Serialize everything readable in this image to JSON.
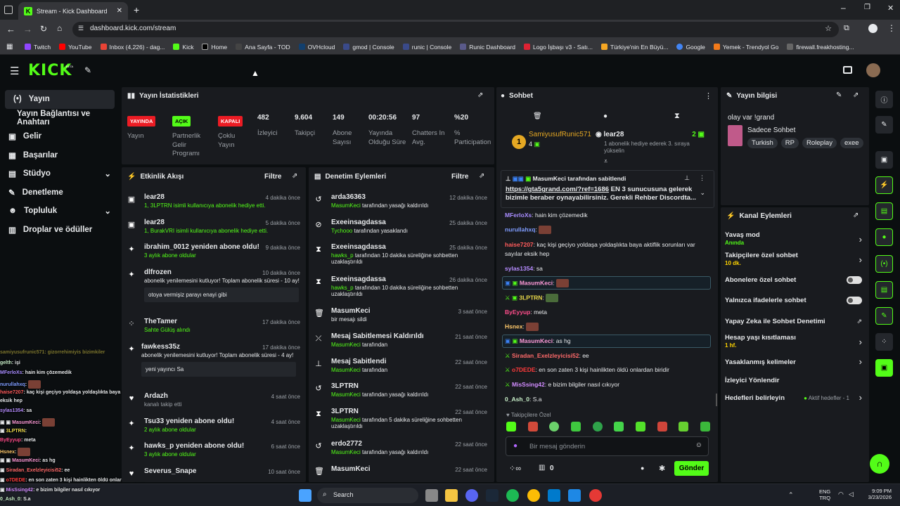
{
  "browser": {
    "tab_title": "Stream - Kick Dashboard",
    "url": "dashboard.kick.com/stream",
    "bookmarks": [
      "Twitch",
      "YouTube",
      "Inbox (4,226) - dag...",
      "Kick",
      "Home",
      "Ana Sayfa - TOD",
      "OVHcloud",
      "gmod | Console",
      "runic | Console",
      "Runic Dashboard",
      "Logo İşbaşı v3 - Satı...",
      "Türkiye'nin En Büyü...",
      "Google",
      "Yemek - Trendyol Go",
      "firewall.freakhosting..."
    ]
  },
  "header": {
    "logo": "KICK",
    "beta": "BETA"
  },
  "sidebar": {
    "items": [
      {
        "label": "Yayın"
      },
      {
        "label": "Yayın Bağlantısı ve Anahtarı"
      },
      {
        "label": "Gelir"
      },
      {
        "label": "Başarılar"
      },
      {
        "label": "Stüdyo"
      },
      {
        "label": "Denetleme"
      },
      {
        "label": "Topluluk"
      },
      {
        "label": "Droplar ve ödüller"
      }
    ]
  },
  "stats": {
    "title": "Yayın İstatistikleri",
    "items": [
      {
        "value": "YAYINDA",
        "label": "Yayın"
      },
      {
        "value": "AÇIK",
        "label": "Partnerlik Gelir Programı"
      },
      {
        "value": "KAPALI",
        "label": "Çoklu Yayın"
      },
      {
        "value": "482",
        "label": "İzleyici"
      },
      {
        "value": "9.604",
        "label": "Takipçi"
      },
      {
        "value": "149",
        "label": "Abone Sayısı"
      },
      {
        "value": "00:20:56",
        "label": "Yayında Olduğu Süre"
      },
      {
        "value": "97",
        "label": "Chatters In Avg."
      },
      {
        "value": "%20",
        "label": "% Participation"
      }
    ]
  },
  "activity": {
    "title": "Etkinlik Akışı",
    "filter": "Filtre",
    "items": [
      {
        "name": "lear28",
        "time": "4 dakika önce",
        "sub": "1, 3LPTRN isimli kullanıcıya abonelik hediye etti."
      },
      {
        "name": "lear28",
        "time": "5 dakika önce",
        "sub": "1, BurakVRI isimli kullanıcıya abonelik hediye etti."
      },
      {
        "name": "ibrahim_0012 yeniden abone oldu!",
        "time": "9 dakika önce",
        "sub": "3 aylık abone oldular"
      },
      {
        "name": "dlfrozen",
        "time": "10 dakika önce",
        "sub": "abonelik yenilemesini kutluyor! Toplam abonelik süresi - 10 ay!",
        "quote": "otoya vermişiz parayı enayi gibi"
      },
      {
        "name": "TheTamer",
        "time": "17 dakika önce",
        "sub": "Sahte Gülüş alındı"
      },
      {
        "name": "fawkess35z",
        "time": "17 dakika önce",
        "sub": "abonelik yenilemesini kutluyor! Toplam abonelik süresi - 4 ay!",
        "quote": "yeni yayıncı Sa"
      },
      {
        "name": "Ardazh",
        "time": "4 saat önce",
        "sub": "kanalı takip etti"
      },
      {
        "name": "Tsu33 yeniden abone oldu!",
        "time": "4 saat önce",
        "sub": "2 aylık abone oldular"
      },
      {
        "name": "hawks_p yeniden abone oldu!",
        "time": "6 saat önce",
        "sub": "3 aylık abone oldular"
      },
      {
        "name": "Severus_Snape",
        "time": "10 saat önce",
        "sub": ""
      }
    ]
  },
  "moderation": {
    "title": "Denetim Eylemleri",
    "filter": "Filtre",
    "items": [
      {
        "name": "arda36363",
        "time": "12 dakika önce",
        "by": "MasumKeci",
        "sub": "tarafından yasağı kaldırıldı"
      },
      {
        "name": "Exeeinsagdassa",
        "time": "25 dakika önce",
        "by": "Tychooo",
        "sub": "tarafından yasaklandı"
      },
      {
        "name": "Exeeinsagdassa",
        "time": "25 dakika önce",
        "by": "hawks_p",
        "sub": "tarafından 10 dakika süreliğine sohbetten uzaklaştırıldı"
      },
      {
        "name": "Exeeinsagdassa",
        "time": "26 dakika önce",
        "by": "hawks_p",
        "sub": "tarafından 10 dakika süreliğine sohbetten uzaklaştırıldı"
      },
      {
        "name": "MasumKeci",
        "time": "3 saat önce",
        "by": "",
        "sub": "bir mesajı sildi"
      },
      {
        "name": "Mesaj Sabitlemesi Kaldırıldı",
        "time": "21 saat önce",
        "by": "MasumKeci",
        "sub": "tarafından"
      },
      {
        "name": "Mesaj Sabitlendi",
        "time": "22 saat önce",
        "by": "MasumKeci",
        "sub": "tarafından"
      },
      {
        "name": "3LPTRN",
        "time": "22 saat önce",
        "by": "MasumKeci",
        "sub": "tarafından yasağı kaldırıldı"
      },
      {
        "name": "3LPTRN",
        "time": "22 saat önce",
        "by": "MasumKeci",
        "sub": "tarafından 5 dakika süreliğine sohbetten uzaklaştırıldı"
      },
      {
        "name": "erdo2772",
        "time": "22 saat önce",
        "by": "MasumKeci",
        "sub": "tarafından yasağı kaldırıldı"
      },
      {
        "name": "MasumKeci",
        "time": "22 saat önce",
        "by": "",
        "sub": ""
      }
    ]
  },
  "chat": {
    "title": "Sohbet",
    "top_gifter": {
      "name": "SamiyusufRunic571",
      "count": "4"
    },
    "gift_user": {
      "name": "lear28",
      "count": "2",
      "sub": "1 abonelik hediye ederek 3. sıraya yükselin"
    },
    "pinned": {
      "by": "MasumKeci tarafından sabitlendi",
      "link": "https://gta5grand.com/?ref=1686",
      "text": "EN 3 sunucusuna gelerek bizimle beraber oynayabilirsiniz. Gerekli Rehber Discordta..."
    },
    "messages": [
      {
        "user": "MFerloXs",
        "text": "hain kim çözemedik",
        "color": "#a88cff"
      },
      {
        "user": "nurullahxq",
        "text": "",
        "color": "#7f9cff"
      },
      {
        "user": "haise7207",
        "text": "kaç kişi geçiyo yoldaşa yoldaşlıkta baya aktiflik sorunları var sayılar eksik hep",
        "color": "#ff5b5b"
      },
      {
        "user": "sylas1354",
        "text": "sa",
        "color": "#b68cff"
      },
      {
        "user": "MasumKeci",
        "text": "",
        "color": "#ff9ad8"
      },
      {
        "user": "3LPTRN",
        "text": "",
        "color": "#e9d84a"
      },
      {
        "user": "ByEyyup",
        "text": "meta",
        "color": "#ff4d8b"
      },
      {
        "user": "Hsnex",
        "text": "",
        "color": "#ffc96b"
      },
      {
        "user": "MasumKeci",
        "text": "as hg",
        "color": "#ff9ad8"
      },
      {
        "user": "Siradan_Exelzleyicisi52",
        "text": "ee",
        "color": "#ff6a6a"
      },
      {
        "user": "o7DEDE",
        "text": "en son zaten 3 kişi hainlikten öldü onlardan biridir",
        "color": "#ff3b3b"
      },
      {
        "user": "MisSsing42",
        "text": "e bizim bilgiler nasıl cıkıyor",
        "color": "#d18cff"
      },
      {
        "user": "0_Ash_0",
        "text": "S.a",
        "color": "#c9f0c9"
      }
    ],
    "followers_only": "Takipçilere Özel",
    "placeholder": "Bir mesaj gönderin",
    "points": "0",
    "send": "Gönder"
  },
  "stream_info": {
    "title": "Yayın bilgisi",
    "stream_title": "olay var !grand",
    "category": "Sadece Sohbet",
    "tags": [
      "Turkish",
      "RP",
      "Roleplay",
      "exee"
    ]
  },
  "channel_actions": {
    "title": "Kanal Eylemleri",
    "items": [
      {
        "label": "Yavaş mod",
        "sub": "Anında"
      },
      {
        "label": "Takipçilere özel sohbet",
        "sub": "10 dk."
      },
      {
        "label": "Abonelere özel sohbet",
        "sub": ""
      },
      {
        "label": "Yalnızca ifadelerle sohbet",
        "sub": ""
      },
      {
        "label": "Yapay Zeka ile Sohbet Denetimi",
        "sub": ""
      },
      {
        "label": "Hesap yaşı kısıtlaması",
        "sub": "1 hf."
      },
      {
        "label": "Yasaklanmış kelimeler",
        "sub": ""
      },
      {
        "label": "İzleyici Yönlendir",
        "sub": ""
      },
      {
        "label": "Hedefleri belirleyin",
        "sub": "",
        "extra": "Aktif hedefler - 1"
      }
    ]
  },
  "overlay_chat": [
    {
      "user": "gelth",
      "text": ": işi"
    },
    {
      "user": "MFerloXs",
      "text": ": hain kim çözemedik"
    },
    {
      "user": "nurullahxq",
      "text": ":"
    },
    {
      "user": "haise7207",
      "text": ": kaç kişi geçiyo yoldaşa yoldaşlıkta baya aktiflik sorunları var sayılar"
    },
    {
      "user": "eksik hep",
      "text": ""
    },
    {
      "user": "sylas1354",
      "text": ": sa"
    },
    {
      "user": "MasumKeci",
      "text": ":"
    },
    {
      "user": "3LPTRN",
      "text": ":"
    },
    {
      "user": "ByEyyup",
      "text": ": meta"
    },
    {
      "user": "Hsnex",
      "text": ":"
    },
    {
      "user": "MasumKeci",
      "text": ": as hg"
    },
    {
      "user": "Siradan_Exelzleyicisi52",
      "text": ": ee"
    },
    {
      "user": "o7DEDE",
      "text": ": en son zaten 3 kişi hainlikten öldü onlardan biridir"
    },
    {
      "user": "MisSsing42",
      "text": ": e bizim bilgiler nasıl cıkıyor"
    },
    {
      "user": "0_Ash_0",
      "text": ": S.a"
    }
  ],
  "taskbar": {
    "search": "Search",
    "lang": "ENG",
    "lang2": "TRQ",
    "time": "9:09 PM",
    "date": "3/23/2026"
  }
}
